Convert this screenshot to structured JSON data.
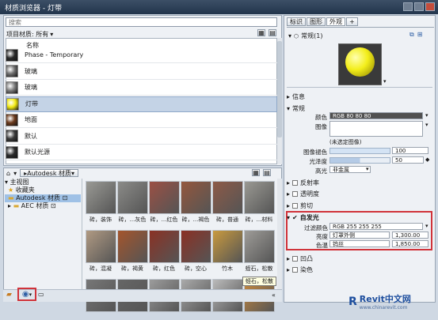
{
  "window": {
    "title": "材质浏览器 - 灯带",
    "accent": "#22354c"
  },
  "search": {
    "placeholder": "搜索"
  },
  "filter": {
    "label": "项目材质: 所有"
  },
  "list": {
    "header": "名称",
    "items": [
      {
        "name": "Phase - Temporary",
        "color": "#2a2a2a",
        "selected": false
      },
      {
        "name": "玻璃",
        "color": "#6d6d6d",
        "selected": false
      },
      {
        "name": "玻璃",
        "color": "#7c7c7c",
        "selected": false
      },
      {
        "name": "灯带",
        "color": "#f2ea12",
        "selected": true
      },
      {
        "name": "地面",
        "color": "#6b3a1c",
        "selected": false
      },
      {
        "name": "默认",
        "color": "#3a3a3a",
        "selected": false
      },
      {
        "name": "默认光源",
        "color": "#2b2b2b",
        "selected": false
      }
    ]
  },
  "library": {
    "breadcrumb": "Autodesk 材质",
    "tree": {
      "root": "主视图",
      "favorites": "收藏夹",
      "autodesk": "Autodesk 材质",
      "aec": "AEC 材质"
    },
    "tiles": [
      {
        "label": "砖，装饰",
        "color": "#9a9a95"
      },
      {
        "label": "砖，...灰色",
        "color": "#8b8b88"
      },
      {
        "label": "砖，...红色",
        "color": "#9b5044"
      },
      {
        "label": "砖，...褐色",
        "color": "#94573d"
      },
      {
        "label": "砖，普通",
        "color": "#8d5a47"
      },
      {
        "label": "砖，...材料",
        "color": "#9a9993"
      },
      {
        "label": "砖，混凝",
        "color": "#b09a83"
      },
      {
        "label": "砖，褐黄",
        "color": "#a4552c"
      },
      {
        "label": "砖，红色",
        "color": "#8a3124"
      },
      {
        "label": "砖，空心",
        "color": "#8a3024"
      },
      {
        "label": "竹木",
        "color": "#c99a3e"
      },
      {
        "label": "蛭石，松散",
        "color": "#9e9c98"
      },
      {
        "label": "",
        "color": "#777"
      },
      {
        "label": "",
        "color": "#666"
      },
      {
        "label": "",
        "color": "#9c9c9c"
      },
      {
        "label": "",
        "color": "#aaa"
      },
      {
        "label": "",
        "color": "#bbb"
      },
      {
        "label": "",
        "color": "#c98a3d"
      }
    ],
    "tooltip": "蛭石，松散"
  },
  "right": {
    "tabs": [
      "标识",
      "图形",
      "外观",
      "+"
    ],
    "asset_name": "常规(1)",
    "preview_color": "#f3ee1a",
    "sections": {
      "info": "信息",
      "general": "常规",
      "reflect": "反射率",
      "transparency": "透明度",
      "cutout": "剪切",
      "selfillum": "自发光",
      "bump": "凹凸",
      "tint": "染色"
    },
    "general_props": {
      "color_label": "颜色",
      "color_value": "RGB 80 80 80",
      "image_label": "图像",
      "image_note": "(未选定图像)",
      "fade_label": "图像褪色",
      "fade_value": "100",
      "gloss_label": "光泽度",
      "gloss_value": "50",
      "highlight_label": "高光",
      "highlight_value": "非金属"
    },
    "selfillum_props": {
      "filter_label": "过滤颜色",
      "filter_value": "RGB 255 255 255",
      "lum_label": "亮度",
      "lum_type": "灯罩外侧",
      "lum_value": "1,300.00",
      "temp_label": "色温",
      "temp_type": "钨丝",
      "temp_value": "1,850.00"
    }
  },
  "watermark": {
    "brand": "Revit中文网",
    "url": "www.chinarevit.com"
  }
}
